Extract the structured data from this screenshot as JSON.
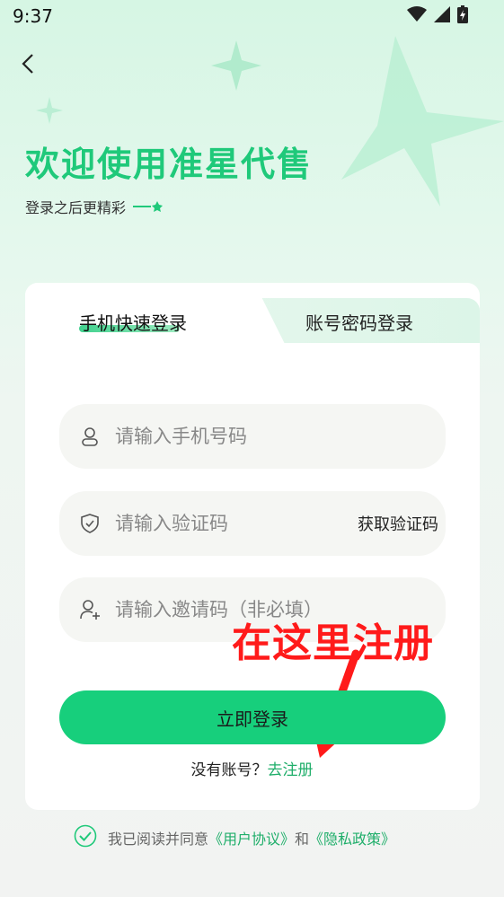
{
  "status_bar": {
    "time": "9:37",
    "icons": [
      "wifi-icon",
      "signal-icon",
      "battery-charging-icon"
    ]
  },
  "header": {
    "back_icon": "chevron-left-icon",
    "title": "欢迎使用准星代售",
    "subtitle": "登录之后更精彩"
  },
  "tabs": [
    {
      "label": "手机快速登录",
      "active": true
    },
    {
      "label": "账号密码登录",
      "active": false
    }
  ],
  "form": {
    "phone": {
      "placeholder": "请输入手机号码",
      "value": "",
      "icon": "user-icon"
    },
    "code": {
      "placeholder": "请输入验证码",
      "value": "",
      "icon": "shield-icon",
      "action_label": "获取验证码"
    },
    "invite": {
      "placeholder": "请输入邀请码（非必填）",
      "value": "",
      "icon": "add-user-icon"
    }
  },
  "login_button_label": "立即登录",
  "register": {
    "prompt": "没有账号？",
    "link": "去注册"
  },
  "annotation": {
    "text": "在这里注册"
  },
  "agreement": {
    "checked": true,
    "prefix": "我已阅读并同意",
    "user_agreement": "《用户协议》",
    "and": "和",
    "privacy_policy": "《隐私政策》"
  },
  "colors": {
    "accent": "#1fc97a",
    "annotation": "#ff1a1a"
  }
}
